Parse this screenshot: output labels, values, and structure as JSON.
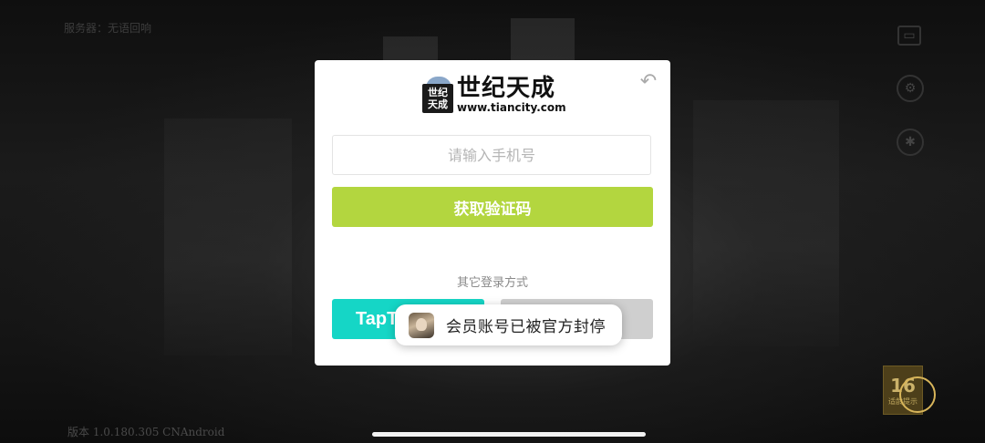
{
  "background": {
    "server_label": "服务器：无语回响",
    "version_label": "版本 1.0.180.305 CNAndroid",
    "age_rating": {
      "number": "16",
      "caption": "适龄提示"
    }
  },
  "dialog": {
    "logo": {
      "mark_text": "世纪\n天成",
      "brand_cn": "世纪天成",
      "brand_url": "www.tiancity.com"
    },
    "back_icon": "back-arrow-icon",
    "phone_input": {
      "placeholder": "请输入手机号",
      "value": ""
    },
    "get_code_button": "获取验证码",
    "other_methods_label": "其它登录方式",
    "taptap_button": "TapT",
    "accent_color": "#b3d63f",
    "taptap_color": "#15d6c6"
  },
  "toast": {
    "icon": "game-avatar-icon",
    "message": "会员账号已被官方封停"
  }
}
